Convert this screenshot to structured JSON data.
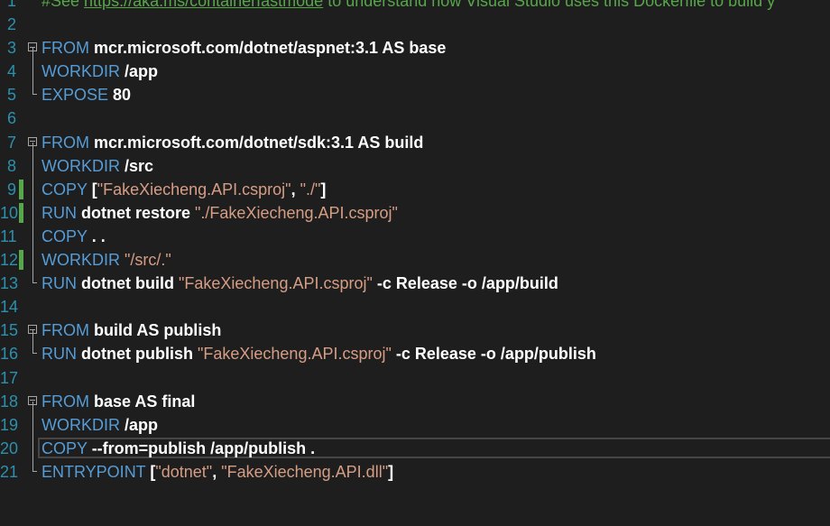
{
  "editor": {
    "lines": [
      {
        "num": "1",
        "tokens": [
          {
            "t": "#See ",
            "c": "cm"
          },
          {
            "t": "https://aka.ms/containerfastmode",
            "c": "link"
          },
          {
            "t": " to understand how Visual Studio uses this Dockerfile to build y",
            "c": "cm"
          }
        ]
      },
      {
        "num": "2",
        "tokens": []
      },
      {
        "num": "3",
        "fold": true,
        "guide": "top",
        "tokens": [
          {
            "t": "FROM ",
            "c": "kw"
          },
          {
            "t": "mcr.microsoft.com/dotnet/aspnet:3.1 AS base",
            "c": "arg"
          }
        ]
      },
      {
        "num": "4",
        "guide": "mid",
        "tokens": [
          {
            "t": "WORKDIR ",
            "c": "kw"
          },
          {
            "t": "/app",
            "c": "arg"
          }
        ]
      },
      {
        "num": "5",
        "guide": "end",
        "tokens": [
          {
            "t": "EXPOSE ",
            "c": "kw"
          },
          {
            "t": "80",
            "c": "arg"
          }
        ]
      },
      {
        "num": "6",
        "tokens": []
      },
      {
        "num": "7",
        "fold": true,
        "guide": "top",
        "tokens": [
          {
            "t": "FROM ",
            "c": "kw"
          },
          {
            "t": "mcr.microsoft.com/dotnet/sdk:3.1 AS build",
            "c": "arg"
          }
        ]
      },
      {
        "num": "8",
        "guide": "mid",
        "tokens": [
          {
            "t": "WORKDIR ",
            "c": "kw"
          },
          {
            "t": "/src",
            "c": "arg"
          }
        ]
      },
      {
        "num": "9",
        "guide": "mid",
        "changed": true,
        "tokens": [
          {
            "t": "COPY ",
            "c": "kw"
          },
          {
            "t": "[",
            "c": "arg"
          },
          {
            "t": "\"FakeXiecheng.API.csproj\"",
            "c": "str"
          },
          {
            "t": ", ",
            "c": "arg"
          },
          {
            "t": "\"./\"",
            "c": "str"
          },
          {
            "t": "]",
            "c": "arg"
          }
        ]
      },
      {
        "num": "10",
        "guide": "mid",
        "changed": true,
        "tokens": [
          {
            "t": "RUN ",
            "c": "kw"
          },
          {
            "t": "dotnet restore ",
            "c": "arg"
          },
          {
            "t": "\"./FakeXiecheng.API.csproj\"",
            "c": "str"
          }
        ]
      },
      {
        "num": "11",
        "guide": "mid",
        "tokens": [
          {
            "t": "COPY ",
            "c": "kw"
          },
          {
            "t": ". .",
            "c": "arg"
          }
        ]
      },
      {
        "num": "12",
        "guide": "mid",
        "changed": true,
        "tokens": [
          {
            "t": "WORKDIR ",
            "c": "kw"
          },
          {
            "t": "\"/src/.\"",
            "c": "str"
          }
        ]
      },
      {
        "num": "13",
        "guide": "end",
        "tokens": [
          {
            "t": "RUN ",
            "c": "kw"
          },
          {
            "t": "dotnet build ",
            "c": "arg"
          },
          {
            "t": "\"FakeXiecheng.API.csproj\"",
            "c": "str"
          },
          {
            "t": " -c Release -o /app/build",
            "c": "arg"
          }
        ]
      },
      {
        "num": "14",
        "tokens": []
      },
      {
        "num": "15",
        "fold": true,
        "guide": "top",
        "tokens": [
          {
            "t": "FROM ",
            "c": "kw"
          },
          {
            "t": "build AS publish",
            "c": "arg"
          }
        ]
      },
      {
        "num": "16",
        "guide": "end",
        "tokens": [
          {
            "t": "RUN ",
            "c": "kw"
          },
          {
            "t": "dotnet publish ",
            "c": "arg"
          },
          {
            "t": "\"FakeXiecheng.API.csproj\"",
            "c": "str"
          },
          {
            "t": " -c Release -o /app/publish",
            "c": "arg"
          }
        ]
      },
      {
        "num": "17",
        "tokens": []
      },
      {
        "num": "18",
        "fold": true,
        "guide": "top",
        "tokens": [
          {
            "t": "FROM ",
            "c": "kw"
          },
          {
            "t": "base AS final",
            "c": "arg"
          }
        ]
      },
      {
        "num": "19",
        "guide": "mid",
        "tokens": [
          {
            "t": "WORKDIR ",
            "c": "kw"
          },
          {
            "t": "/app",
            "c": "arg"
          }
        ]
      },
      {
        "num": "20",
        "guide": "mid",
        "current": true,
        "tokens": [
          {
            "t": "COPY ",
            "c": "kw"
          },
          {
            "t": "--from=publish /app/publish .",
            "c": "arg"
          }
        ]
      },
      {
        "num": "21",
        "guide": "end",
        "tokens": [
          {
            "t": "ENTRYPOINT ",
            "c": "kw"
          },
          {
            "t": "[",
            "c": "arg"
          },
          {
            "t": "\"dotnet\"",
            "c": "str"
          },
          {
            "t": ", ",
            "c": "arg"
          },
          {
            "t": "\"FakeXiecheng.API.dll\"",
            "c": "str"
          },
          {
            "t": "]",
            "c": "arg"
          }
        ]
      }
    ]
  },
  "colors": {
    "background": "#1e1e1e",
    "line_number": "#2b91af",
    "keyword": "#569cd6",
    "string": "#d69d85",
    "argument": "#ffffff",
    "comment": "#57a64a",
    "change_bar": "#57a64a"
  }
}
